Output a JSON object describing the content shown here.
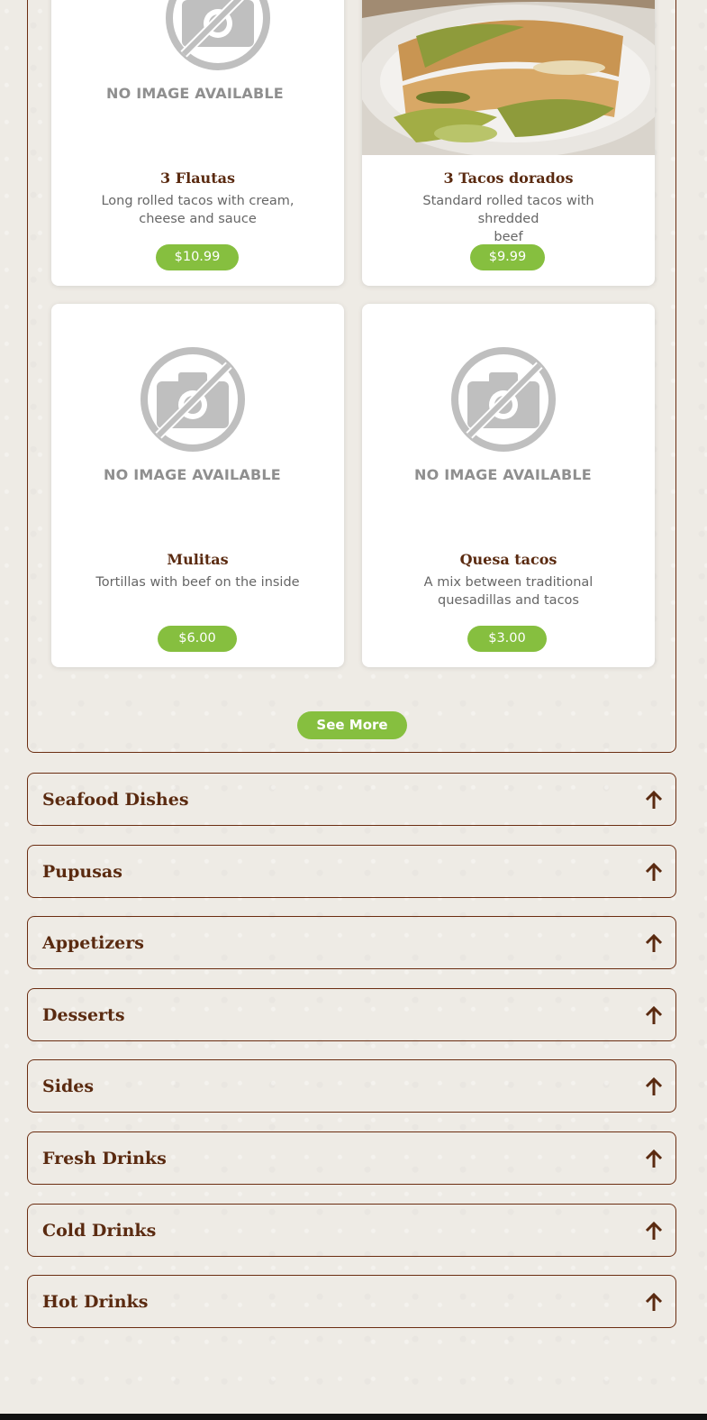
{
  "placeholder_text": "NO IMAGE AVAILABLE",
  "see_more": "See More",
  "items": [
    {
      "name": "3 Flautas",
      "desc_lines": [
        "Long rolled tacos with cream,",
        "cheese and sauce"
      ],
      "price": "$10.99",
      "image": "no-image"
    },
    {
      "name": "3 Tacos dorados",
      "desc_lines": [
        "Standard rolled tacos with shredded",
        "beef"
      ],
      "price": "$9.99",
      "image": "photo"
    },
    {
      "name": "Mulitas",
      "desc_lines": [
        "Tortillas with beef on the inside"
      ],
      "price": "$6.00",
      "image": "no-image"
    },
    {
      "name": "Quesa tacos",
      "desc_lines": [
        "A mix between traditional",
        "quesadillas and tacos"
      ],
      "price": "$3.00",
      "image": "no-image"
    }
  ],
  "categories": [
    {
      "label": "Seafood Dishes"
    },
    {
      "label": "Pupusas"
    },
    {
      "label": "Appetizers"
    },
    {
      "label": "Desserts"
    },
    {
      "label": "Sides"
    },
    {
      "label": "Fresh Drinks"
    },
    {
      "label": "Cold Drinks"
    },
    {
      "label": "Hot Drinks"
    }
  ],
  "colors": {
    "brown": "#5a2a10",
    "green": "#86bf3f",
    "placeholder_gray": "#bfbfbf"
  }
}
